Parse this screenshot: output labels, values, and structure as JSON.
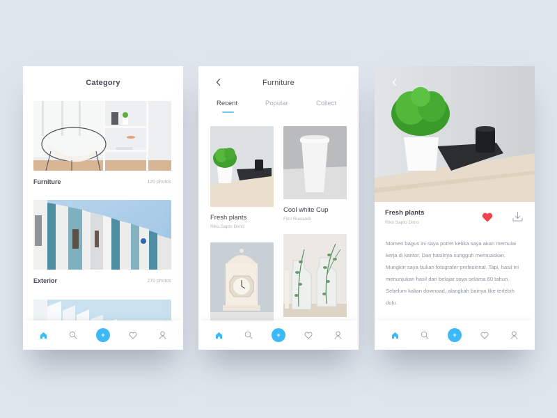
{
  "colors": {
    "accent": "#3cb9f6",
    "heart": "#f0454f",
    "background": "#dfe5ec"
  },
  "nav": {
    "items": [
      {
        "icon": "home-icon",
        "active": true
      },
      {
        "icon": "search-icon"
      },
      {
        "icon": "add-icon",
        "label": "+"
      },
      {
        "icon": "heart-icon"
      },
      {
        "icon": "user-icon"
      }
    ]
  },
  "category_screen": {
    "title": "Category",
    "categories": [
      {
        "name": "Furniture",
        "count": "120 photos",
        "image": "chair-and-shelf-photo"
      },
      {
        "name": "Exterior",
        "count": "270 photos",
        "image": "building-facade-photo"
      },
      {
        "name": "",
        "count": "",
        "image": "white-architecture-photo"
      }
    ]
  },
  "furniture_screen": {
    "title": "Furniture",
    "tabs": [
      {
        "label": "Recent",
        "active": true
      },
      {
        "label": "Popular"
      },
      {
        "label": "Collect"
      }
    ],
    "items": [
      {
        "title": "Fresh plants",
        "author": "Riko Sapto Dimo",
        "image": "plant-on-desk-photo"
      },
      {
        "title": "Cool white Cup",
        "author": "Fikri Ruslandi",
        "image": "white-cup-photo"
      },
      {
        "title": "",
        "author": "",
        "image": "vintage-clock-photo"
      },
      {
        "title": "",
        "author": "",
        "image": "glass-bottles-plants-photo"
      }
    ]
  },
  "detail_screen": {
    "title": "Fresh plants",
    "author": "Riko Sapto Dimo",
    "liked": true,
    "description": "Momen bagus ini saya potret ketika saya akan memulai kerja di kantor. Dan hasilnya sungguh memuaskan. Mungkin saya bukan fotografer profesional. Tapi, hasil ini menunjukan hasil dari belajar saya selama 60 tahun. Sebelum kalian downoad, alangkah bainya like terlebih dulu."
  }
}
